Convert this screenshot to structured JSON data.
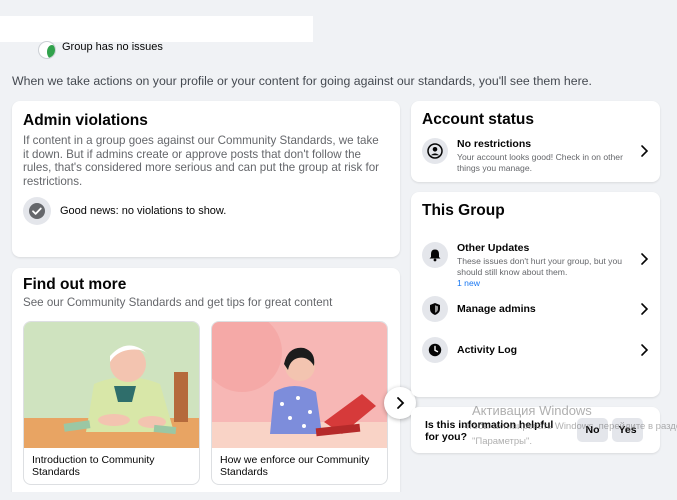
{
  "group_status": "Group has no issues",
  "intro_text": "When we take actions on your profile or your content for going against our standards, you'll see them here.",
  "admin_violations": {
    "title": "Admin violations",
    "description": "If content in a group goes against our Community Standards, we take it down. But if admins create or approve posts that don't follow the rules, that's considered more serious and can put the group at risk for restrictions.",
    "good_news": "Good news: no violations to show."
  },
  "find_out_more": {
    "title": "Find out more",
    "subtitle": "See our Community Standards and get tips for great content",
    "tiles": [
      {
        "caption": "Introduction to Community Standards"
      },
      {
        "caption": "How we enforce our Community Standards"
      }
    ]
  },
  "account_status": {
    "title": "Account status",
    "item": {
      "title": "No restrictions",
      "desc": "Your account looks good! Check in on other things you manage."
    }
  },
  "this_group": {
    "title": "This Group",
    "other_updates": {
      "title": "Other Updates",
      "desc": "These issues don't hurt your group, but you should still know about them.",
      "badge": "1 new"
    },
    "manage_admins": "Manage admins",
    "activity_log": "Activity Log"
  },
  "feedback": {
    "question": "Is this information helpful for you?",
    "no": "No",
    "yes": "Yes"
  },
  "watermark": {
    "line1": "Активация Windows",
    "line2": "Чтобы активировать Windows, перейдите в раздел",
    "line3": "\"Параметры\"."
  },
  "colors": {
    "background": "#f0f2f5",
    "card": "#ffffff",
    "accent": "#1877f2",
    "success": "#31a24c"
  }
}
